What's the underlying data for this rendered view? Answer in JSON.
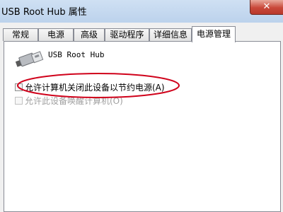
{
  "window": {
    "title": "USB Root Hub 属性",
    "close_label": "✕"
  },
  "tabs": [
    {
      "label": "常规",
      "active": false
    },
    {
      "label": "电源",
      "active": false
    },
    {
      "label": "高级",
      "active": false
    },
    {
      "label": "驱动程序",
      "active": false
    },
    {
      "label": "详细信息",
      "active": false
    },
    {
      "label": "电源管理",
      "active": true
    }
  ],
  "device": {
    "icon": "usb-connector-icon",
    "name": "USB Root Hub"
  },
  "options": [
    {
      "label": "允许计算机关闭此设备以节约电源(A)",
      "checked": false,
      "enabled": true
    },
    {
      "label": "允许此设备唤醒计算机(O)",
      "checked": false,
      "enabled": false
    }
  ],
  "annotation": {
    "type": "ellipse-highlight",
    "color": "#d0021b"
  }
}
